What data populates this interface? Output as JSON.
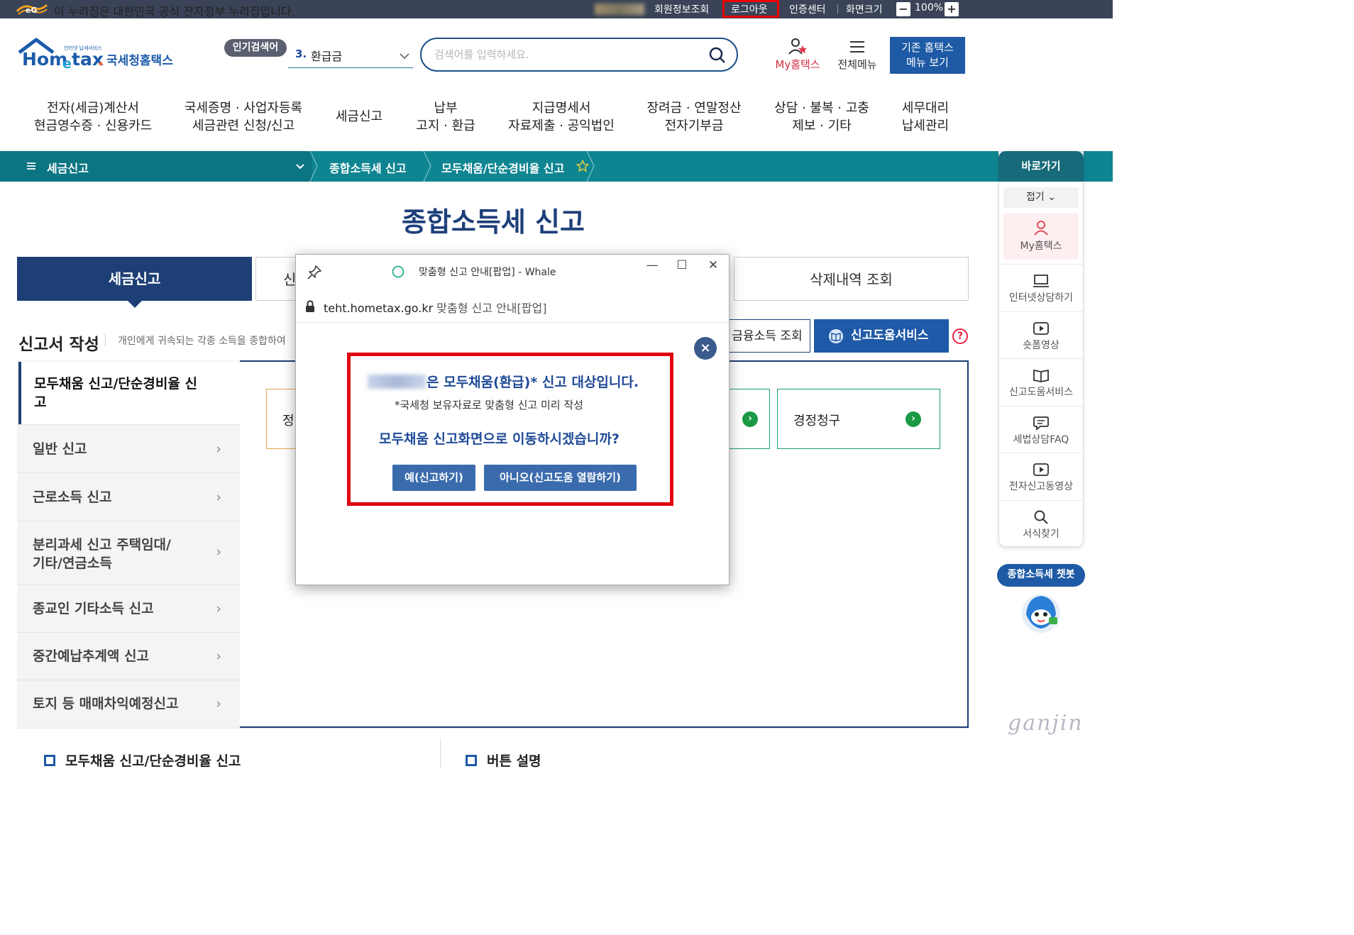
{
  "govbar": {
    "notice": "이 누리집은 대한민국 공식 전자정부 누리집입니다.",
    "member_info": "회원정보조회",
    "logout": "로그아웃",
    "cert_center": "인증센터",
    "screen_size": "화면크기",
    "zoom": "100%",
    "zoom_minus": "−",
    "zoom_plus": "+"
  },
  "header": {
    "logo_sub": "국세청홈택스",
    "popular_badge": "인기검색어",
    "popular_rank": "3.",
    "popular_keyword": "환급금",
    "search_placeholder": "검색어를 입력하세요.",
    "my_hometax": "My홈택스",
    "all_menu": "전체메뉴",
    "old_menu_line1": "기존 홈택스",
    "old_menu_line2": "메뉴 보기"
  },
  "gnb": [
    {
      "l1": "전자(세금)계산서",
      "l2": "현금영수증 · 신용카드"
    },
    {
      "l1": "국세증명 · 사업자등록",
      "l2": "세금관련 신청/신고"
    },
    {
      "l1": "세금신고",
      "l2": ""
    },
    {
      "l1": "납부",
      "l2": "고지 · 환급"
    },
    {
      "l1": "지급명세서",
      "l2": "자료제출 · 공익법인"
    },
    {
      "l1": "장려금 · 연말정산",
      "l2": "전자기부금"
    },
    {
      "l1": "상담 · 불복 · 고충",
      "l2": "제보 · 기타"
    },
    {
      "l1": "세무대리",
      "l2": "납세관리"
    }
  ],
  "breadcrumb": {
    "menu": "세금신고",
    "level2": "종합소득세 신고",
    "level3": "모두채움/단순경비율 신고"
  },
  "quick": {
    "title": "바로가기",
    "fold": "접기",
    "items": [
      "My홈택스",
      "인터넷상담하기",
      "숏폼영상",
      "신고도움서비스",
      "세법상담FAQ",
      "전자신고동영상",
      "서식찾기"
    ],
    "chatbot": "종합소득세 챗봇"
  },
  "main": {
    "title": "종합소득세 신고",
    "tab_active": "세금신고",
    "tab2_partial": "신",
    "tab_delete": "삭제내역 조회",
    "section_title": "신고서 작성",
    "section_desc": "개인에게 귀속되는 각종 소득을 종합하여",
    "finance_btn": "금융소득 조회",
    "help_btn": "신고도움서비스",
    "help_q": "?",
    "side_active": "모두채움 신고/단순경비율 신고",
    "side_items": [
      "일반 신고",
      "근로소득 신고",
      "분리과세 신고 주택임대/기타/연금소득",
      "종교인 기타소득 신고",
      "중간예납추계액 신고",
      "토지 등 매매차익예정신고"
    ],
    "card_partial": "정",
    "card_correction": "경정청구",
    "bottom_left": "모두채움 신고/단순경비율 신고",
    "bottom_right": "버튼 설명",
    "watermark": "ganjin"
  },
  "popup": {
    "window_title": "맞춤형 신고 안내[팝업] - Whale",
    "url_host": "teht.hometax.go.kr",
    "url_title": "맞춤형 신고 안내[팝업]",
    "msg_line1": "은 모두채움(환급)* 신고 대상입니다.",
    "msg_line2": "*국세청 보유자료로 맞춤형 신고 미리 작성",
    "msg_line3": "모두채움 신고화면으로 이동하시겠습니까?",
    "yes_btn": "예(신고하기)",
    "no_btn": "아니오(신고도움 열람하기)"
  },
  "colors": {
    "govbar": "#3a4357",
    "teal": "#0f8592",
    "navy": "#1e3f75",
    "highlight_red": "#e00010",
    "popup_button": "#3a6cad"
  }
}
